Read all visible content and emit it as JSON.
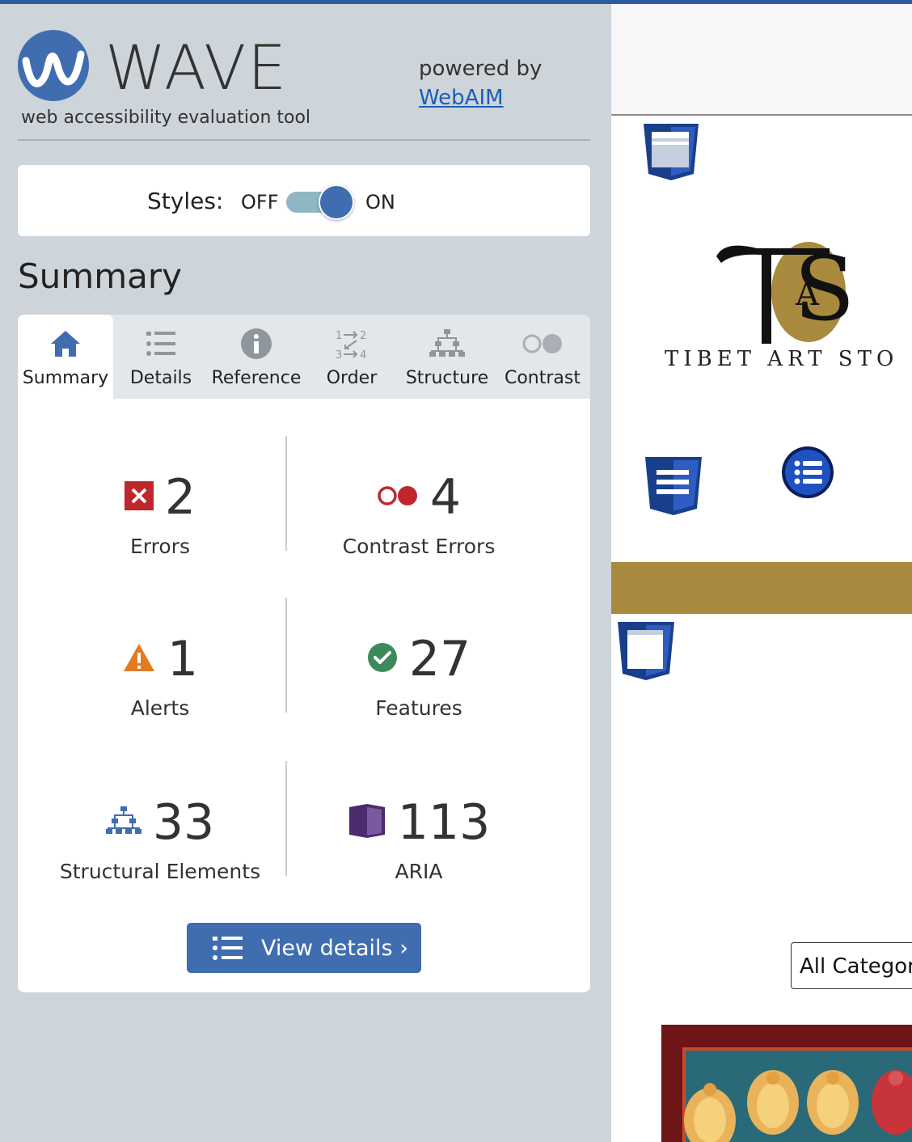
{
  "wave": {
    "logo_text": "WAVE",
    "tagline": "web accessibility evaluation tool",
    "powered_by": "powered by",
    "webaim_link": "WebAIM"
  },
  "styles": {
    "label": "Styles:",
    "off": "OFF",
    "on": "ON",
    "state": "on"
  },
  "summary_heading": "Summary",
  "tabs": [
    {
      "label": "Summary",
      "icon": "home-icon",
      "active": true
    },
    {
      "label": "Details",
      "icon": "list-icon"
    },
    {
      "label": "Reference",
      "icon": "info-icon"
    },
    {
      "label": "Order",
      "icon": "order-icon"
    },
    {
      "label": "Structure",
      "icon": "structure-icon"
    },
    {
      "label": "Contrast",
      "icon": "contrast-icon"
    }
  ],
  "stats": [
    {
      "count": "2",
      "label": "Errors",
      "icon": "error-icon",
      "color": "#c0272d"
    },
    {
      "count": "4",
      "label": "Contrast Errors",
      "icon": "contrast-error-icon",
      "color": "#c0272d"
    },
    {
      "count": "1",
      "label": "Alerts",
      "icon": "alert-icon",
      "color": "#e07b22"
    },
    {
      "count": "27",
      "label": "Features",
      "icon": "feature-icon",
      "color": "#3c8a5c"
    },
    {
      "count": "33",
      "label": "Structural Elements",
      "icon": "structure-icon",
      "color": "#3f6db0"
    },
    {
      "count": "113",
      "label": "ARIA",
      "icon": "aria-icon",
      "color": "#4b2a6e"
    }
  ],
  "view_details": "View details ›",
  "preview": {
    "brand_text": "TIBET ART STO",
    "category_select": "All Categor"
  },
  "colors": {
    "sidebar_bg": "#cdd4da",
    "accent": "#3f6db0",
    "gold": "#a8893e"
  }
}
